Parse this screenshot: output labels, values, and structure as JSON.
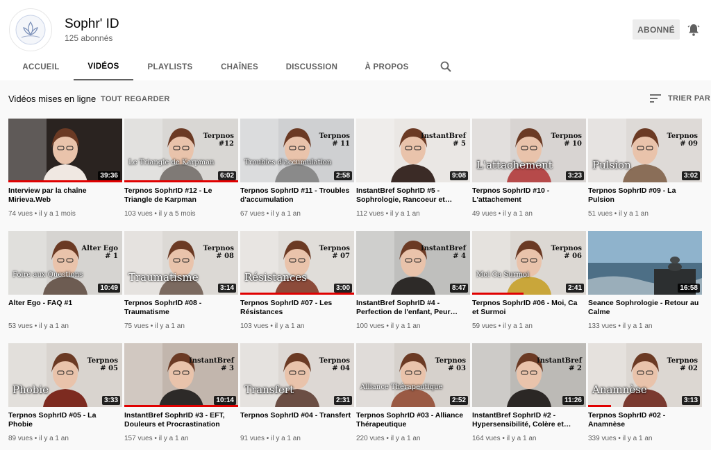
{
  "channel": {
    "name": "Sophr' ID",
    "subscribers": "125 abonnés",
    "subscribe_label": "ABONNÉ",
    "bell_icon": "bell-icon"
  },
  "tabs": [
    {
      "label": "ACCUEIL"
    },
    {
      "label": "VIDÉOS",
      "active": true
    },
    {
      "label": "PLAYLISTS"
    },
    {
      "label": "CHAÎNES"
    },
    {
      "label": "DISCUSSION"
    },
    {
      "label": "À PROPOS"
    }
  ],
  "section": {
    "title": "Vidéos mises en ligne",
    "watch_all": "TOUT REGARDER",
    "sort_label": "TRIER PAR"
  },
  "videos": [
    {
      "title": "Interview par la chaîne Mirieva.Web",
      "views": "74 vues",
      "age": "il y a 1 mois",
      "duration": "39:36",
      "progress": 1.0,
      "overlay": "",
      "corner": ""
    },
    {
      "title": "Terpnos SophrID #12 - Le Triangle de Karpman",
      "views": "103 vues",
      "age": "il y a 5 mois",
      "duration": "6:02",
      "progress": 1.0,
      "overlay": "Le Triangle de Karpman",
      "corner": "Terpnos\n#12"
    },
    {
      "title": "Terpnos SophrID #11 - Troubles d'accumulation",
      "views": "67 vues",
      "age": "il y a 1 an",
      "duration": "2:58",
      "progress": 0,
      "overlay": "Troubles d'accumulation",
      "corner": "Terpnos\n# 11"
    },
    {
      "title": "InstantBref SophrID #5 - Sophrologie, Rancoeur et…",
      "views": "112 vues",
      "age": "il y a 1 an",
      "duration": "9:08",
      "progress": 0,
      "overlay": "",
      "corner": "InstantBref\n# 5"
    },
    {
      "title": "Terpnos SophrID #10 - L'attachement",
      "views": "49 vues",
      "age": "il y a 1 an",
      "duration": "3:23",
      "progress": 0,
      "overlay": "L'attachement",
      "corner": "Terpnos\n# 10"
    },
    {
      "title": "Terpnos SophrID #09 - La Pulsion",
      "views": "51 vues",
      "age": "il y a 1 an",
      "duration": "3:02",
      "progress": 0,
      "overlay": "Pulsion",
      "corner": "Terpnos\n# 09"
    },
    {
      "title": "Alter Ego - FAQ #1",
      "views": "53 vues",
      "age": "il y a 1 an",
      "duration": "10:49",
      "progress": 0,
      "overlay": "Foire aux Questions",
      "corner": "Alter Ego\n# 1"
    },
    {
      "title": "Terpnos SophrID #08 - Traumatisme",
      "views": "75 vues",
      "age": "il y a 1 an",
      "duration": "3:14",
      "progress": 0,
      "overlay": "Traumatisme",
      "corner": "Terpnos\n# 08"
    },
    {
      "title": "Terpnos SophrID #07 - Les Résistances",
      "views": "103 vues",
      "age": "il y a 1 an",
      "duration": "3:00",
      "progress": 1.0,
      "overlay": "Résistances",
      "corner": "Terpnos\n# 07"
    },
    {
      "title": "InstantBref SophrID #4 - Perfection de l'enfant, Peur…",
      "views": "100 vues",
      "age": "il y a 1 an",
      "duration": "8:47",
      "progress": 0,
      "overlay": "",
      "corner": "InstantBref\n# 4"
    },
    {
      "title": "Terpnos SophrID #06 - Moi, Ca et Surmoi",
      "views": "59 vues",
      "age": "il y a 1 an",
      "duration": "2:41",
      "progress": 0.45,
      "overlay": "Moi   Ca   Surmoi",
      "corner": "Terpnos\n# 06"
    },
    {
      "title": "Seance Sophrologie - Retour au Calme",
      "views": "133 vues",
      "age": "il y a 1 an",
      "duration": "16:58",
      "progress": 0,
      "overlay": "",
      "corner": ""
    },
    {
      "title": "Terpnos SophrID #05 - La Phobie",
      "views": "89 vues",
      "age": "il y a 1 an",
      "duration": "3:33",
      "progress": 0,
      "overlay": "Phobie",
      "corner": "Terpnos\n# 05"
    },
    {
      "title": "InstantBref SophrID #3 - EFT, Douleurs et Procrastination",
      "views": "157 vues",
      "age": "il y a 1 an",
      "duration": "10:14",
      "progress": 1.0,
      "overlay": "",
      "corner": "InstantBref\n# 3"
    },
    {
      "title": "Terpnos SophrID #04 - Transfert",
      "views": "91 vues",
      "age": "il y a 1 an",
      "duration": "2:31",
      "progress": 0,
      "overlay": "Transfert",
      "corner": "Terpnos\n# 04"
    },
    {
      "title": "Terpnos SophrID #03 - Alliance Thérapeutique",
      "views": "220 vues",
      "age": "il y a 1 an",
      "duration": "2:52",
      "progress": 0,
      "overlay": "Alliance Thérapeutique",
      "corner": "Terpnos\n# 03"
    },
    {
      "title": "InstantBref SophrID #2 - Hypersensibilité, Colère et…",
      "views": "164 vues",
      "age": "il y a 1 an",
      "duration": "11:26",
      "progress": 0,
      "overlay": "",
      "corner": "InstantBref\n# 2"
    },
    {
      "title": "Terpnos SophrID #02 - Anamnèse",
      "views": "339 vues",
      "age": "il y a 1 an",
      "duration": "3:13",
      "progress": 0.2,
      "overlay": "Anamnèse",
      "corner": "Terpnos\n# 02"
    }
  ],
  "colors": {
    "progress": "#e00000",
    "accent_text": "#030303",
    "muted_text": "#606060"
  }
}
